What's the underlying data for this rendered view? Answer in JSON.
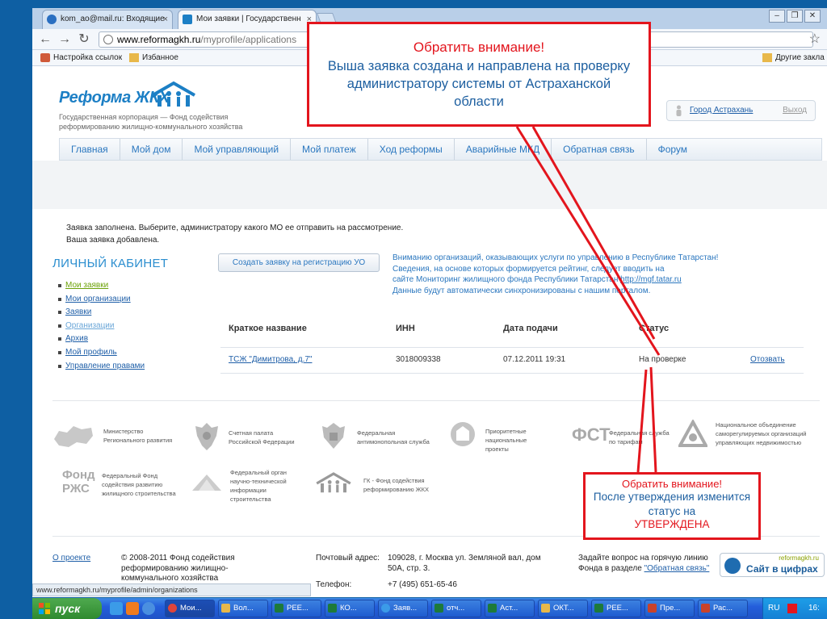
{
  "browser": {
    "tabs": [
      {
        "title": "kom_ao@mail.ru: Входящие"
      },
      {
        "title": "Мои заявки | Государственн"
      }
    ],
    "url_host": "www.reformagkh.ru",
    "url_path": "/myprofile/applications",
    "bookmarks": {
      "settings": "Настройка ссылок",
      "favorites": "Избанное",
      "other": "Другие закла"
    }
  },
  "site": {
    "logo": "Реформа ЖКХ",
    "subtitle": "Государственная корпорация — Фонд содействия реформированию жилищно-коммунального хозяйства",
    "city_link": "Город Астрахань",
    "logout": "Выход",
    "menu": [
      "Главная",
      "Мой дом",
      "Мой управляющий",
      "Мой платеж",
      "Ход реформы",
      "Аварийные МКД",
      "Обратная связь",
      "Форум"
    ]
  },
  "notice": {
    "line1": "Заявка заполнена. Выберите, администратору какого МО ее отправить на рассмотрение.",
    "line2": "Ваша заявка добавлена."
  },
  "cabinet": {
    "title": "ЛИЧНЫЙ КАБИНЕТ",
    "items": [
      "Мои заявки",
      "Мои организации",
      "Заявки",
      "Организации",
      "Архив",
      "Мой профиль",
      "Управление правами"
    ]
  },
  "create_button": "Создать заявку на регистрацию УО",
  "info": {
    "lines": [
      "Вниманию организаций, оказывающих услуги по управлению в Республике Татарстан!",
      "Сведения, на основе которых формируется рейтинг, следует вводить на",
      "сайте Мониторинг жилищного фонда Республики Татарстан"
    ],
    "link": "http://mgf.tatar.ru",
    "last": "Данные будут автоматически синхронизированы с нашим порталом."
  },
  "table": {
    "headers": [
      "Краткое название",
      "ИНН",
      "Дата подачи",
      "Статус"
    ],
    "rows": [
      {
        "name": "ТСЖ \"Димитрова, д.7\"",
        "inn": "3018009338",
        "date": "07.12.2011 19:31",
        "status": "На проверке",
        "action": "Отозвать"
      }
    ]
  },
  "partners": [
    {
      "name": "Министерство Регионального развития"
    },
    {
      "name": "Счетная палата Российской Федерации"
    },
    {
      "name": "Федеральная антимонопольная служба"
    },
    {
      "name": "Приоритетные национальные проекты"
    },
    {
      "abbr": "ФСТ",
      "name": "Федеральная служба по тарифам"
    },
    {
      "name": "Национальное объединение саморегулируемых организаций управляющих недвижимостью"
    },
    {
      "abbr": "Фонд РЖС",
      "name": "Федеральный Фонд содействия развитию жилищного строительства"
    },
    {
      "name": "Федеральный орган научно-технической информации строительства"
    },
    {
      "name": "ГК - Фонд содействия реформированию ЖКХ"
    }
  ],
  "footer": {
    "about": "О проекте",
    "copyright": "© 2008-2011 Фонд содействия реформированию жилищно-коммунального хозяйства",
    "address_label": "Почтовый адрес:",
    "address": "109028, г. Москва ул. Земляной вал, дом 50А, стр. 3.",
    "phone_label": "Телефон:",
    "phone": "+7 (495) 651-65-46",
    "question": "Задайте вопрос на горячую линию Фонда в разделе",
    "feedback_link": "\"Обратная связь\"",
    "badge_site": "reformagkh.ru",
    "badge_label": "Сайт в цифрах"
  },
  "status_bar": "www.reformagkh.ru/myprofile/admin/organizations",
  "callouts": {
    "top_heading": "Обратить внимание!",
    "top_body": "Выша заявка создана и направлена на проверку администратору системы от Астраханской области",
    "bottom_heading": "Обратить внимание!",
    "bottom_body": "После утверждения изменится статус на",
    "bottom_status": "УТВЕРЖДЕНА"
  },
  "taskbar": {
    "start": "пуск",
    "tasks": [
      "Мои...",
      "Вол...",
      "РЕЕ...",
      "КО...",
      "Заяв...",
      "отч...",
      "Аст...",
      "ОКТ...",
      "РЕЕ...",
      "Пре...",
      "Рас..."
    ],
    "lang": "RU",
    "time": "16:"
  },
  "colors": {
    "accent": "#1c7fc5",
    "link": "#1f5fa8",
    "annotation": "#e3151d",
    "taskbar": "#245edb"
  }
}
